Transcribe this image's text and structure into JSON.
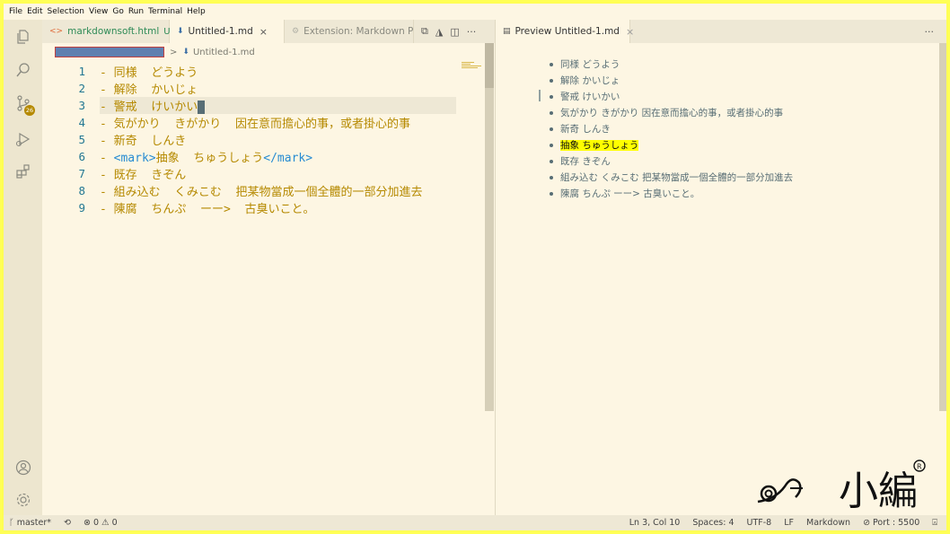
{
  "menu": [
    "File",
    "Edit",
    "Selection",
    "View",
    "Go",
    "Run",
    "Terminal",
    "Help"
  ],
  "activity": {
    "scm_badge": "26"
  },
  "tabs_left": [
    {
      "label": "markdownsoft.html",
      "icon": "html-icon",
      "status": "U",
      "active": false
    },
    {
      "label": "Untitled-1.md",
      "icon": "markdown-icon",
      "close": "×",
      "active": true
    },
    {
      "label": "Extension: Markdown Pr",
      "icon": "extension-icon",
      "active": false
    }
  ],
  "tab_actions_more": "···",
  "tabs_right": [
    {
      "label": "Preview Untitled-1.md",
      "close": "×"
    }
  ],
  "tabs_right_more": "···",
  "breadcrumb": {
    "separator": ">",
    "file": "Untitled-1.md"
  },
  "editor": {
    "current_line": 3,
    "lines": [
      {
        "n": "1",
        "text": "- 同様  どうよう"
      },
      {
        "n": "2",
        "text": "- 解除  かいじょ"
      },
      {
        "n": "3",
        "text": "- 警戒  けいかい"
      },
      {
        "n": "4",
        "text": "- 気がかり  きがかり  因在意而擔心的事，或者掛心的事"
      },
      {
        "n": "5",
        "text": "- 新奇  しんき"
      },
      {
        "n": "6",
        "pre": "- ",
        "tag_open": "<mark>",
        "inner": "抽象  ちゅうしょう",
        "tag_close": "</mark>"
      },
      {
        "n": "7",
        "text": "- 既存  きぞん"
      },
      {
        "n": "8",
        "text": "- 組み込む  くみこむ  把某物當成一個全體的一部分加進去"
      },
      {
        "n": "9",
        "text": "- 陳腐  ちんぷ  ーー>  古臭いこと。"
      }
    ]
  },
  "preview": {
    "items": [
      {
        "text": "同様  どうよう"
      },
      {
        "text": "解除  かいじょ"
      },
      {
        "text": "警戒  けいかい"
      },
      {
        "text": "気がかり  きがかり  因在意而擔心的事，或者掛心的事"
      },
      {
        "text": "新奇  しんき"
      },
      {
        "text": "抽象  ちゅうしょう",
        "mark": true
      },
      {
        "text": "既存  きぞん"
      },
      {
        "text": "組み込む  くみこむ  把某物當成一個全體的一部分加進去"
      },
      {
        "text": "陳腐  ちんぷ  ーー>  古臭いこと。"
      }
    ]
  },
  "watermark": {
    "text": "小編"
  },
  "status": {
    "branch": "master*",
    "problems_errors": "0",
    "problems_warnings": "0",
    "position": "Ln 3, Col 10",
    "spaces": "Spaces: 4",
    "encoding": "UTF-8",
    "eol": "LF",
    "language": "Markdown",
    "port": "Port : 5500"
  },
  "colors": {
    "accent": "#ffff55",
    "text_yellow": "#b58900",
    "tag_blue": "#268bd2",
    "line_number": "#237893"
  }
}
